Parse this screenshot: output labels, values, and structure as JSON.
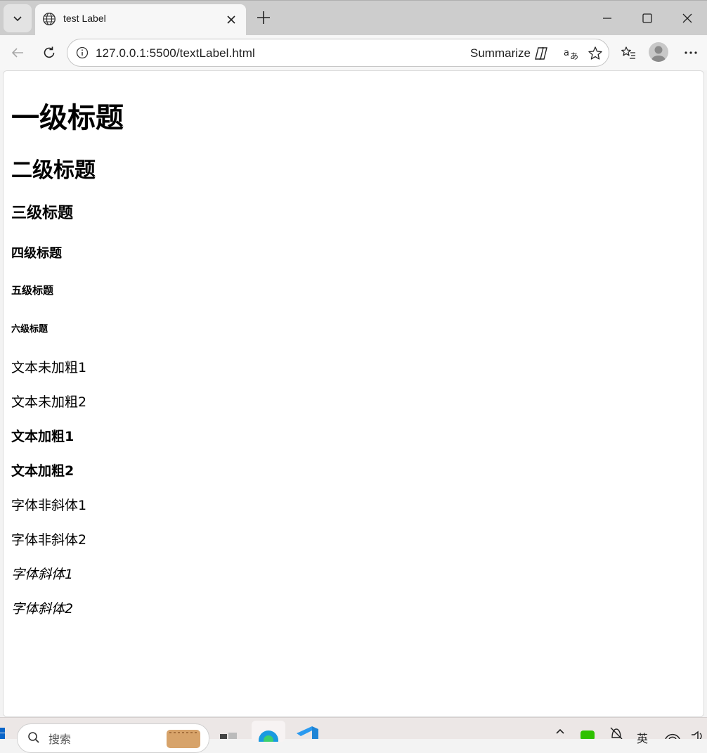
{
  "browser": {
    "tab": {
      "title": "test Label"
    },
    "address_bar": {
      "url": "127.0.0.1:5500/textLabel.html",
      "summarize_label": "Summarize"
    }
  },
  "page": {
    "headings": [
      "一级标题",
      "二级标题",
      "三级标题",
      "四级标题",
      "五级标题",
      "六级标题"
    ],
    "paragraphs": [
      {
        "text": "文本未加粗1",
        "style": "normal"
      },
      {
        "text": "文本未加粗2",
        "style": "normal"
      },
      {
        "text": "文本加粗1",
        "style": "bold"
      },
      {
        "text": "文本加粗2",
        "style": "bold"
      },
      {
        "text": "字体非斜体1",
        "style": "normal"
      },
      {
        "text": "字体非斜体2",
        "style": "normal"
      },
      {
        "text": "字体斜体1",
        "style": "italic"
      },
      {
        "text": "字体斜体2",
        "style": "italic"
      }
    ]
  },
  "taskbar": {
    "search_label": "搜索",
    "tray_language": "英"
  },
  "colors": {
    "tab_strip": "#cdcdcd",
    "toolbar": "#f7f7f7",
    "taskbar": "#ece7e6"
  }
}
